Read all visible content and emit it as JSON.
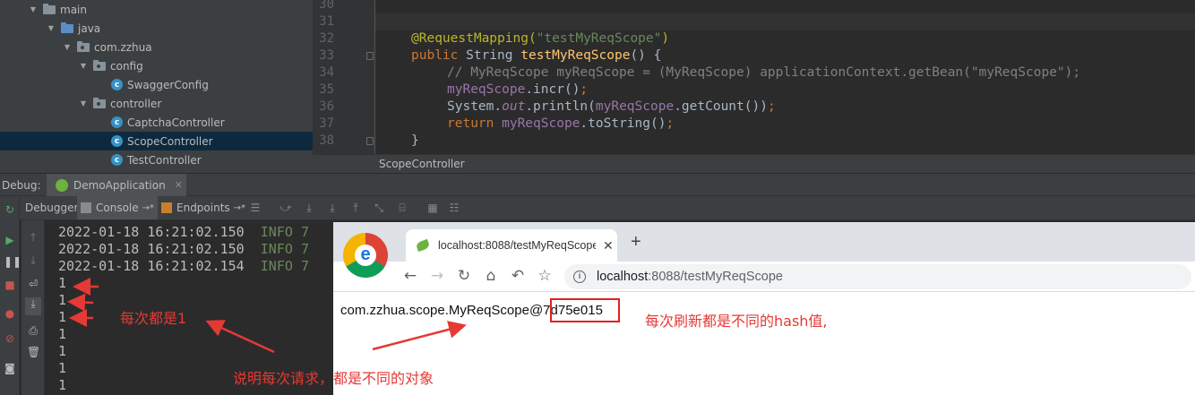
{
  "project_tree": {
    "items": [
      {
        "label": "main",
        "type": "folder"
      },
      {
        "label": "java",
        "type": "source-folder"
      },
      {
        "label": "com.zzhua",
        "type": "package"
      },
      {
        "label": "config",
        "type": "package"
      },
      {
        "label": "SwaggerConfig",
        "type": "class"
      },
      {
        "label": "controller",
        "type": "package"
      },
      {
        "label": "CaptchaController",
        "type": "class"
      },
      {
        "label": "ScopeController",
        "type": "class",
        "selected": true
      },
      {
        "label": "TestController",
        "type": "class"
      }
    ]
  },
  "editor": {
    "line_numbers": [
      "30",
      "31",
      "32",
      "33",
      "34",
      "35",
      "36",
      "37",
      "38"
    ],
    "code": {
      "l32_annotation": "@RequestMapping(",
      "l32_string": "\"testMyReqScope\"",
      "l32_close": ")",
      "l33_public": "public",
      "l33_type": " String ",
      "l33_name": "testMyReqScope",
      "l33_rest": "() {",
      "l34_comment": "// MyReqScope myReqScope = (MyReqScope) applicationContext.getBean(\"myReqScope\");",
      "l35_field": "myReqScope",
      "l35_rest": ".incr()",
      "l35_semi": ";",
      "l36_system": "System.",
      "l36_out": "out",
      "l36_println": ".println(",
      "l36_field": "myReqScope",
      "l36_rest": ".getCount())",
      "l36_semi": ";",
      "l37_return": "return",
      "l37_field": " myReqScope",
      "l37_rest": ".toString()",
      "l37_semi": ";",
      "l38_brace": "}"
    },
    "breadcrumb": "ScopeController"
  },
  "debug": {
    "label": "Debug:",
    "session_tab": "DemoApplication",
    "tabs": {
      "debugger": "Debugger",
      "console": "Console",
      "endpoints": "Endpoints"
    },
    "pin_glyph": "→*"
  },
  "console": {
    "log_lines": [
      {
        "timestamp": "2022-01-18 16:21:02.150",
        "level": "INFO",
        "tail": "7"
      },
      {
        "timestamp": "2022-01-18 16:21:02.150",
        "level": "INFO",
        "tail": "7"
      },
      {
        "timestamp": "2022-01-18 16:21:02.154",
        "level": "INFO",
        "tail": "7"
      }
    ],
    "outputs": [
      "1",
      "1",
      "1",
      "1",
      "1",
      "1",
      "1"
    ]
  },
  "browser": {
    "tab_title": "localhost:8088/testMyReqScope",
    "tab_close": "✕",
    "new_tab": "+",
    "url_host": "localhost",
    "url_path": ":8088/testMyReqScope",
    "page_prefix": "com.zzhua.scope.MyReqScope@",
    "page_hash": "7d75e015"
  },
  "annotations": {
    "note_same_value": "每次都是1",
    "note_hash": "每次刷新都是不同的hash值,",
    "note_objects": "说明每次请求，都是不同的对象"
  },
  "colors": {
    "annotation_red": "#e53935",
    "ide_bg": "#2b2b2b",
    "panel_bg": "#3c3f41"
  }
}
